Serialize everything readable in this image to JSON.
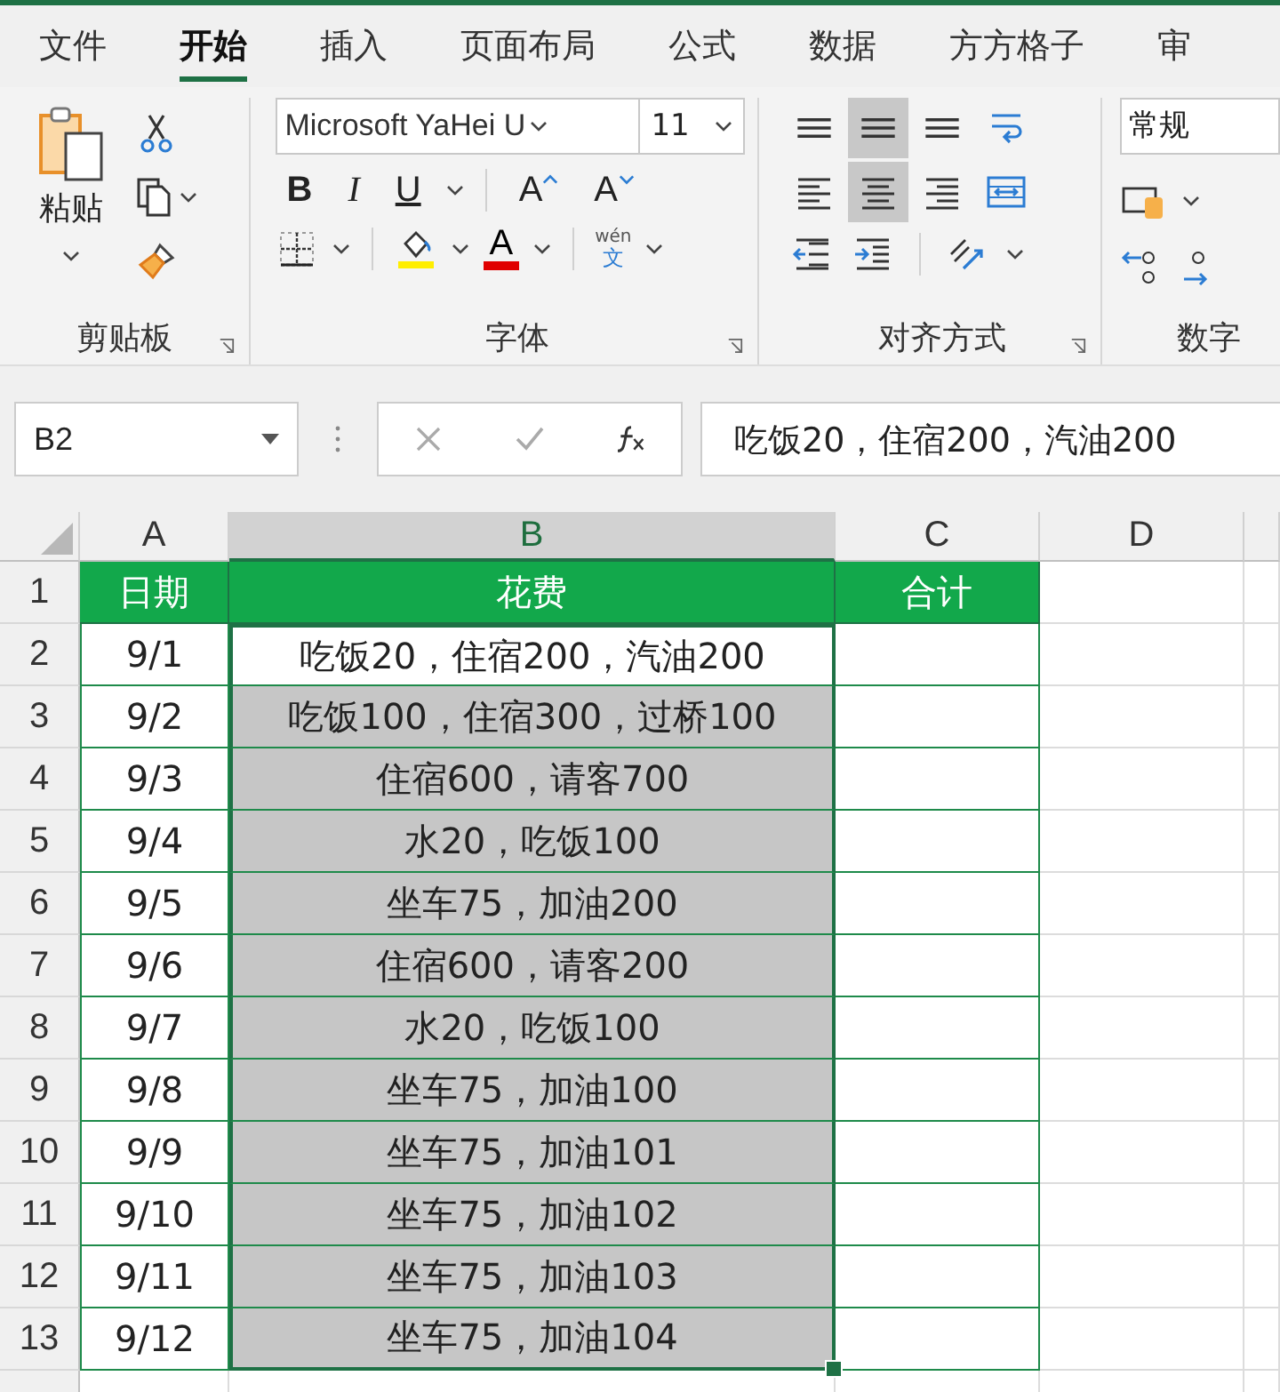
{
  "tabs": [
    {
      "label": "文件",
      "selected": false
    },
    {
      "label": "开始",
      "selected": true
    },
    {
      "label": "插入",
      "selected": false
    },
    {
      "label": "页面布局",
      "selected": false
    },
    {
      "label": "公式",
      "selected": false
    },
    {
      "label": "数据",
      "selected": false
    },
    {
      "label": "方方格子",
      "selected": false
    },
    {
      "label": "审",
      "selected": false
    }
  ],
  "ribbon": {
    "clipboard": {
      "label": "剪贴板",
      "paste": "粘贴"
    },
    "font": {
      "label": "字体",
      "font_name": "Microsoft YaHei U",
      "font_size": "11",
      "bold": "B",
      "italic": "I",
      "underline": "U",
      "grow": "A",
      "shrink": "A",
      "font_color": "A",
      "phonetic_top": "wén",
      "phonetic_bottom": "文"
    },
    "alignment": {
      "label": "对齐方式",
      "buttons": [
        {
          "kind": "top",
          "selected": false
        },
        {
          "kind": "middle",
          "selected": true
        },
        {
          "kind": "bottom",
          "selected": false
        },
        {
          "kind": "wrap",
          "selected": false
        },
        {
          "kind": "left",
          "selected": false
        },
        {
          "kind": "center",
          "selected": true
        },
        {
          "kind": "right",
          "selected": false
        },
        {
          "kind": "merge",
          "selected": false
        }
      ]
    },
    "number": {
      "label": "数字",
      "format": "常规"
    }
  },
  "formula_bar": {
    "name_box": "B2",
    "formula": "吃饭20，住宿200，汽油200"
  },
  "sheet": {
    "columns": [
      {
        "label": "A",
        "selected": false
      },
      {
        "label": "B",
        "selected": true
      },
      {
        "label": "C",
        "selected": false
      },
      {
        "label": "D",
        "selected": false
      }
    ],
    "header": {
      "row": "1",
      "cells": [
        "日期",
        "花费",
        "合计"
      ]
    },
    "rows": [
      {
        "row": "2",
        "date": "9/1",
        "cost": "吃饭20，住宿200，汽油200",
        "selected": true,
        "active": true
      },
      {
        "row": "3",
        "date": "9/2",
        "cost": "吃饭100，住宿300，过桥100",
        "selected": true,
        "active": false
      },
      {
        "row": "4",
        "date": "9/3",
        "cost": "住宿600，请客700",
        "selected": true,
        "active": false
      },
      {
        "row": "5",
        "date": "9/4",
        "cost": "水20，吃饭100",
        "selected": true,
        "active": false
      },
      {
        "row": "6",
        "date": "9/5",
        "cost": "坐车75，加油200",
        "selected": true,
        "active": false
      },
      {
        "row": "7",
        "date": "9/6",
        "cost": "住宿600，请客200",
        "selected": true,
        "active": false
      },
      {
        "row": "8",
        "date": "9/7",
        "cost": "水20，吃饭100",
        "selected": true,
        "active": false
      },
      {
        "row": "9",
        "date": "9/8",
        "cost": "坐车75，加油100",
        "selected": true,
        "active": false
      },
      {
        "row": "10",
        "date": "9/9",
        "cost": "坐车75，加油101",
        "selected": true,
        "active": false
      },
      {
        "row": "11",
        "date": "9/10",
        "cost": "坐车75，加油102",
        "selected": true,
        "active": false
      },
      {
        "row": "12",
        "date": "9/11",
        "cost": "坐车75，加油103",
        "selected": true,
        "active": false
      },
      {
        "row": "13",
        "date": "9/12",
        "cost": "坐车75，加油104",
        "selected": true,
        "active": false
      }
    ]
  }
}
